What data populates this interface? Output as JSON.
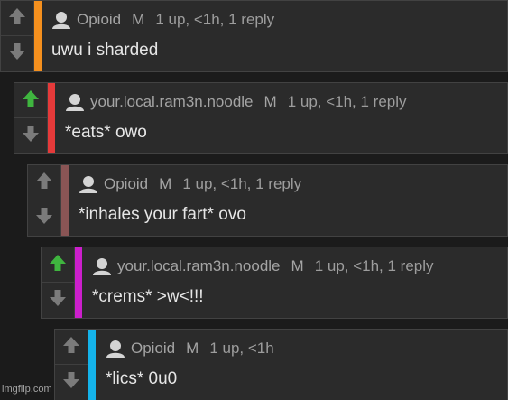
{
  "comments": [
    {
      "username": "Opioid",
      "mod_badge": "M",
      "meta": "1 up, <1h, 1 reply",
      "body": "uwu i sharded",
      "bar_color": "#f5901e",
      "upvoted": false
    },
    {
      "username": "your.local.ram3n.noodle",
      "mod_badge": "M",
      "meta": "1 up, <1h, 1 reply",
      "body": "*eats* owo",
      "bar_color": "#e53a3a",
      "upvoted": true
    },
    {
      "username": "Opioid",
      "mod_badge": "M",
      "meta": "1 up, <1h, 1 reply",
      "body": "*inhales your fart* ovo",
      "bar_color": "#8a5555",
      "upvoted": false
    },
    {
      "username": "your.local.ram3n.noodle",
      "mod_badge": "M",
      "meta": "1 up, <1h, 1 reply",
      "body": "*crems* >w<!!!",
      "bar_color": "#cc1fcc",
      "upvoted": true
    },
    {
      "username": "Opioid",
      "mod_badge": "M",
      "meta": "1 up, <1h",
      "body": "*lics* 0u0",
      "bar_color": "#14b3ea",
      "upvoted": false
    }
  ],
  "icons": {
    "upvote": "arrow-up-icon",
    "downvote": "arrow-down-icon",
    "avatar": "user-avatar-icon"
  },
  "colors": {
    "upvote_active": "#3fb53f",
    "arrow_inactive": "#7b7b7b"
  },
  "watermark": "imgflip.com"
}
